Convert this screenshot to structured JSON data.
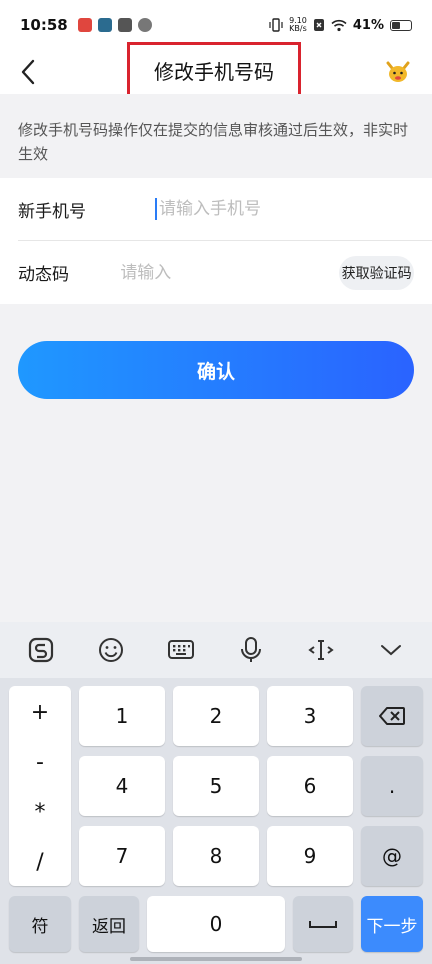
{
  "status_bar": {
    "time": "10:58",
    "net_speed_top": "9.10",
    "net_speed_bottom": "KB/s",
    "battery": "41%",
    "battery_level": 0.41
  },
  "header": {
    "title": "修改手机号码"
  },
  "notice": {
    "text": "修改手机号码操作仅在提交的信息审核通过后生效，非实时生效"
  },
  "form": {
    "phone_label": "新手机号",
    "phone_placeholder": "请输入手机号",
    "phone_value": "",
    "code_label": "动态码",
    "code_placeholder": "请输入",
    "code_value": "",
    "get_code_label": "获取验证码"
  },
  "confirm_label": "确认",
  "keyboard": {
    "side_symbols": [
      "+",
      "-",
      "*",
      "/"
    ],
    "digits": [
      "1",
      "2",
      "3",
      "4",
      "5",
      "6",
      "7",
      "8",
      "9",
      "0"
    ],
    "dot": ".",
    "at": "@",
    "symbol_key": "符",
    "back_key": "返回",
    "next_key": "下一步"
  },
  "colors": {
    "accent": "#2a63ff",
    "title_outline": "#d9232e"
  }
}
